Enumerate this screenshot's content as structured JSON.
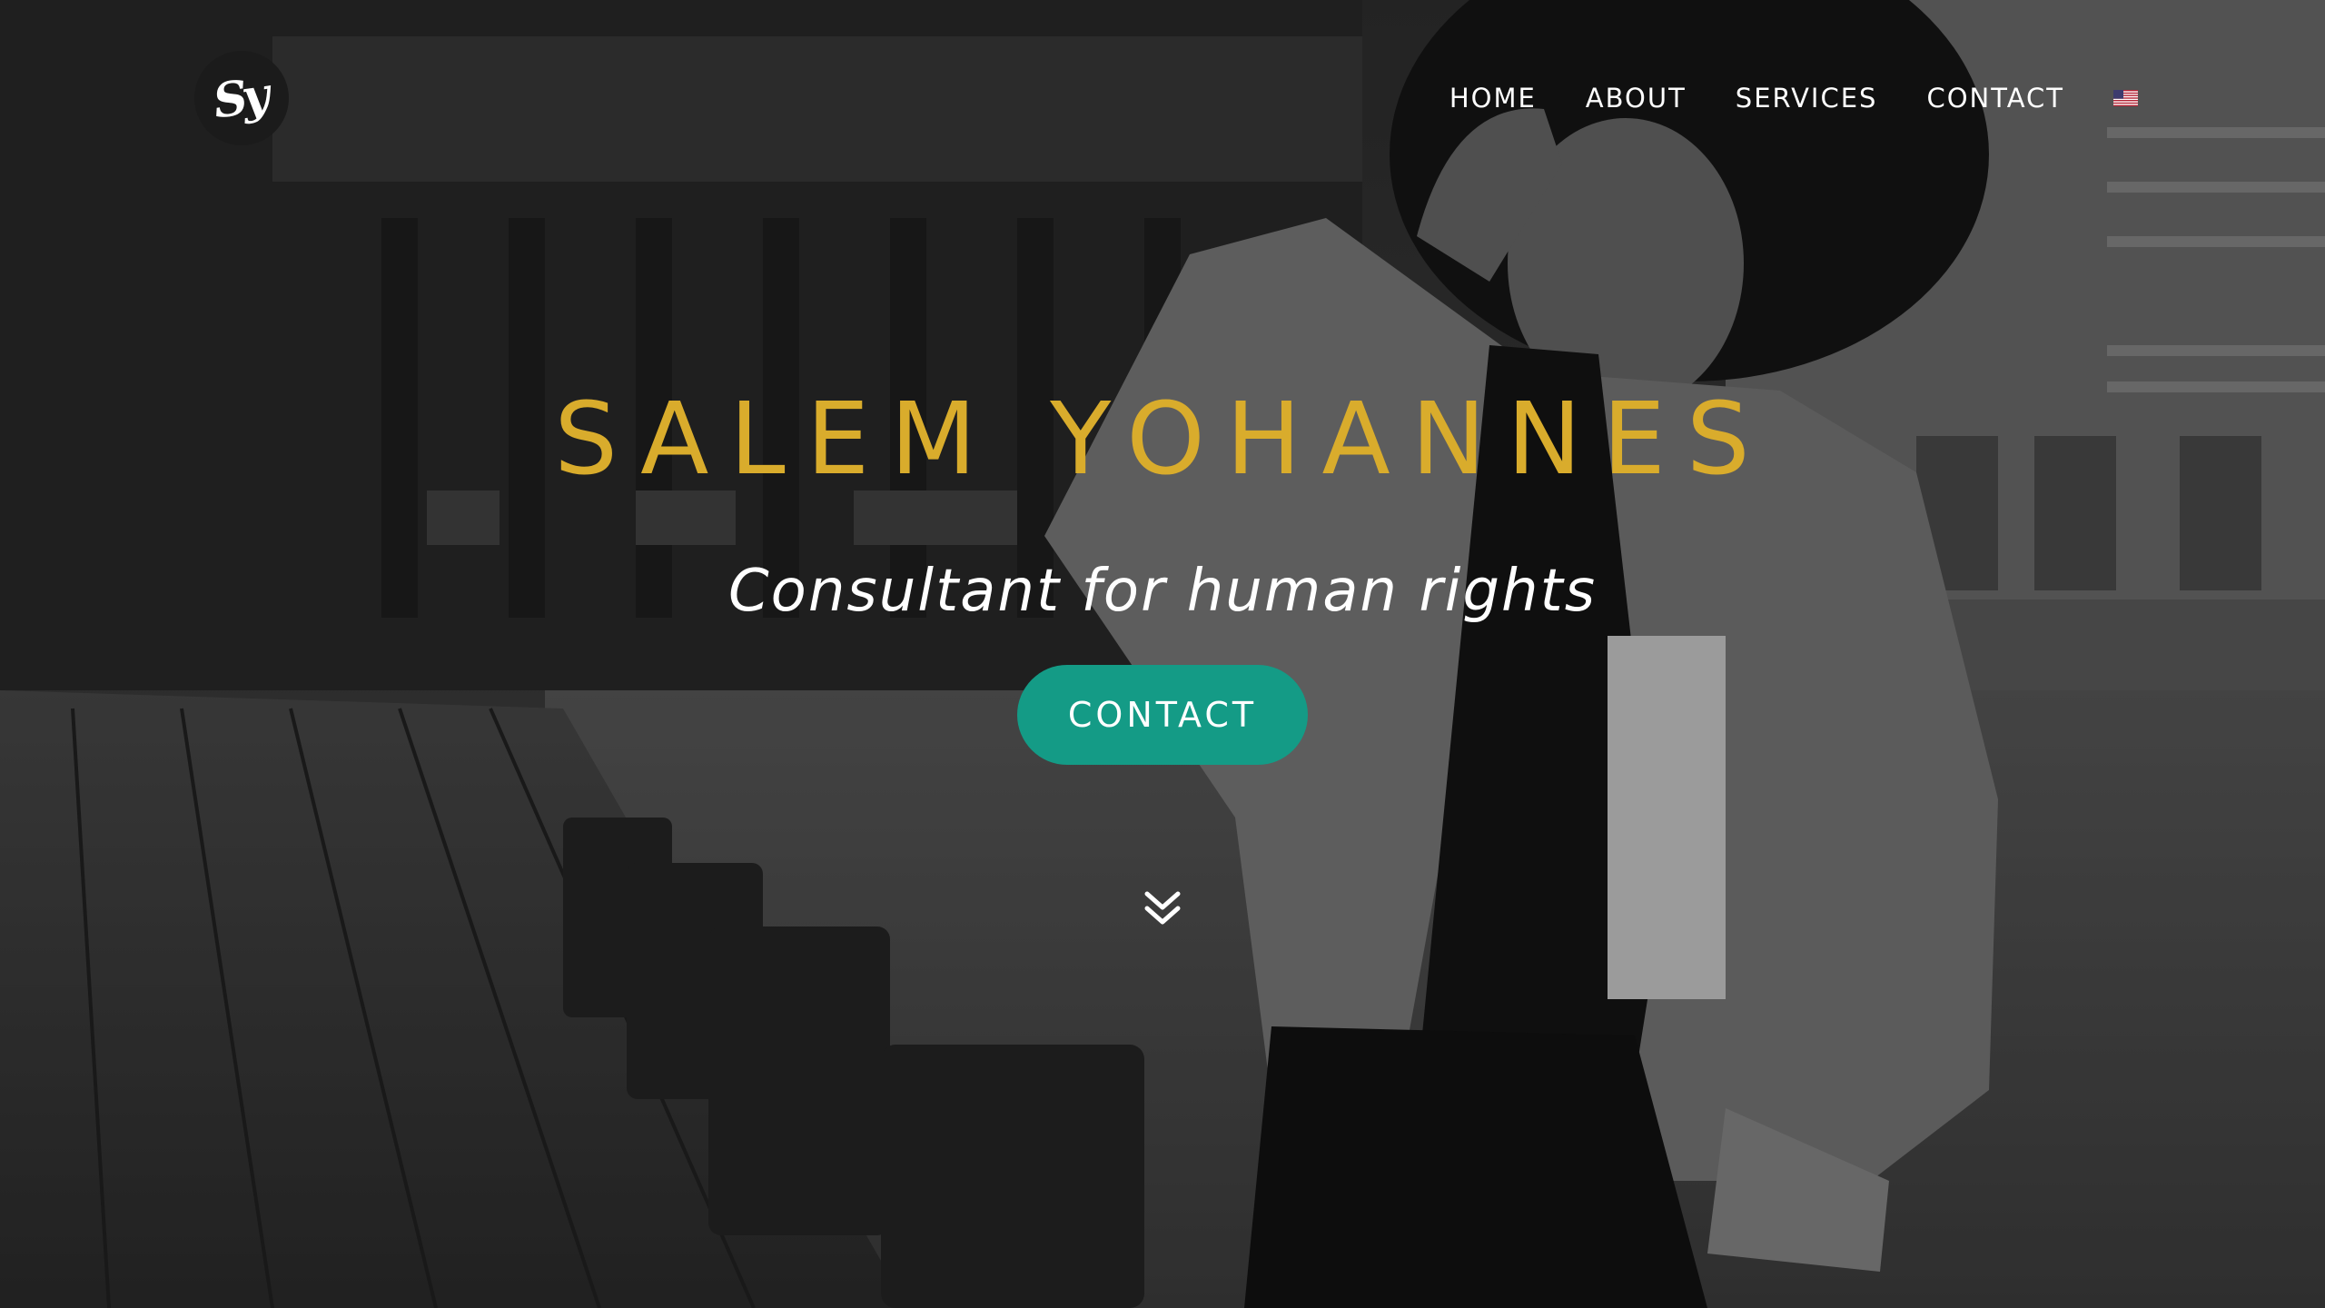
{
  "colors": {
    "title": "#d9ac2c",
    "cta_background": "#149b86",
    "nav_text": "#ffffff",
    "logo_background": "#1b1b1b"
  },
  "logo": {
    "text": "Sy",
    "icon": "signature-monogram-logo"
  },
  "nav": {
    "items": [
      "HOME",
      "ABOUT",
      "SERVICES",
      "CONTACT"
    ],
    "language_icon": "us-flag-icon"
  },
  "hero": {
    "title": "SALEM YOHANNES",
    "subtitle": "Consultant for human rights",
    "cta_label": "CONTACT",
    "scroll_icon": "double-chevron-down-icon"
  }
}
